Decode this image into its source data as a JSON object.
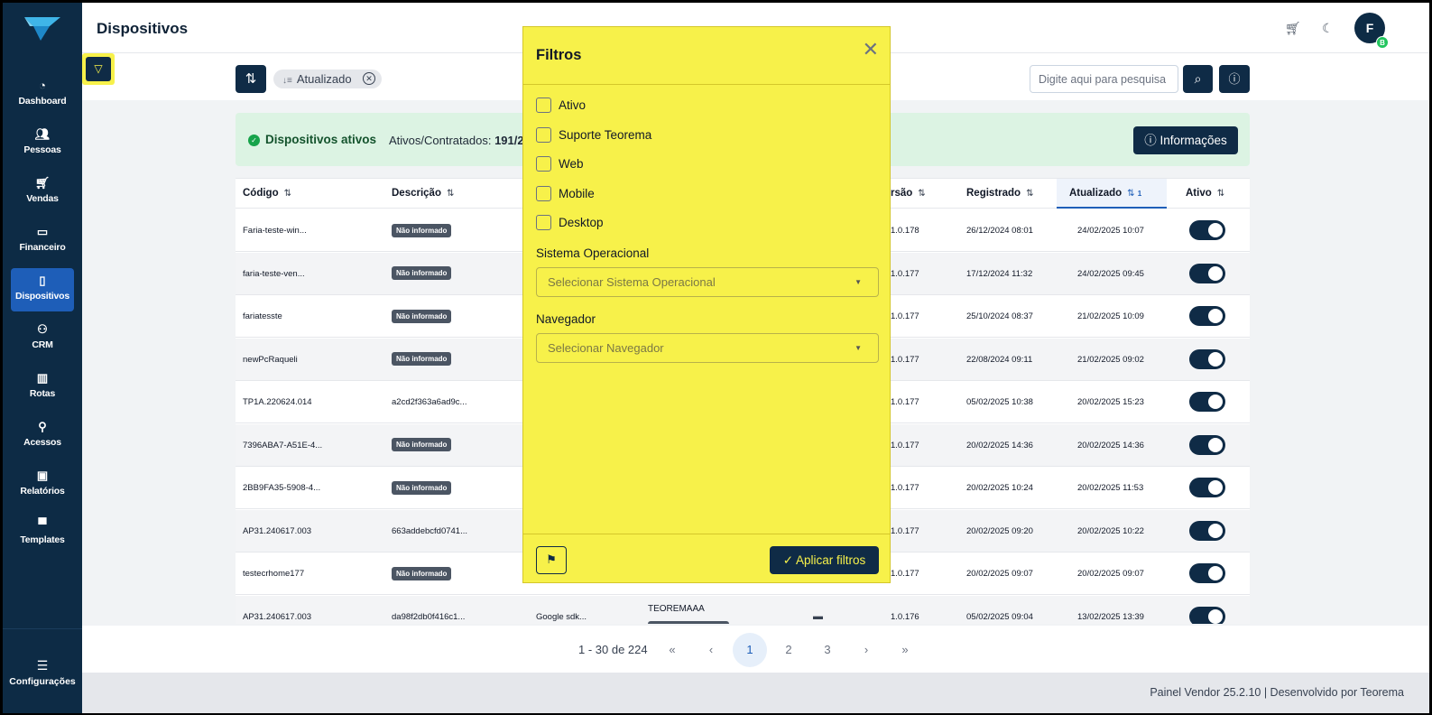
{
  "app": {
    "title": "Dispositivos",
    "brand_color": "#0d2b45",
    "accent_color": "#1e5eb8",
    "highlight_color": "#f7f14a"
  },
  "sidebar": {
    "logo": "teorema-logo",
    "items": [
      {
        "label": "Dashboard",
        "icon": "dashboard-icon"
      },
      {
        "label": "Pessoas",
        "icon": "people-icon"
      },
      {
        "label": "Vendas",
        "icon": "cart-icon"
      },
      {
        "label": "Financeiro",
        "icon": "wallet-icon"
      },
      {
        "label": "Dispositivos",
        "icon": "device-icon",
        "active": true
      },
      {
        "label": "CRM",
        "icon": "crm-icon"
      },
      {
        "label": "Rotas",
        "icon": "map-icon"
      },
      {
        "label": "Acessos",
        "icon": "access-icon"
      },
      {
        "label": "Relatórios",
        "icon": "report-icon"
      },
      {
        "label": "Templates",
        "icon": "template-icon"
      }
    ],
    "config_label": "Configurações"
  },
  "header": {
    "avatar_letter": "F",
    "avatar_badge": "B"
  },
  "toolbar": {
    "chip_label": "Atualizado",
    "search_placeholder": "Digite aqui para pesquisa"
  },
  "status": {
    "title": "Dispositivos ativos",
    "ratio_label": "Ativos/Contratados:",
    "ratio_value": "191/2",
    "info_label": "Informações"
  },
  "table": {
    "headers": {
      "codigo": "Código",
      "descricao": "Descrição",
      "versao": "rsão",
      "registrado": "Registrado",
      "atualizado": "Atualizado",
      "atualizado_order": "1",
      "ativo": "Ativo"
    },
    "rows": [
      {
        "codigo": "Faria-teste-win...",
        "descricao": "Não informado",
        "desc_badge": true,
        "versao": "1.0.178",
        "registrado": "26/12/2024 08:01",
        "atualizado": "24/02/2025 10:07"
      },
      {
        "codigo": "faria-teste-ven...",
        "descricao": "Não informado",
        "desc_badge": true,
        "versao": "1.0.177",
        "registrado": "17/12/2024 11:32",
        "atualizado": "24/02/2025 09:45"
      },
      {
        "codigo": "fariatesste",
        "descricao": "Não informado",
        "desc_badge": true,
        "versao": "1.0.177",
        "registrado": "25/10/2024 08:37",
        "atualizado": "21/02/2025 10:09"
      },
      {
        "codigo": "newPcRaqueli",
        "descricao": "Não informado",
        "desc_badge": true,
        "versao": "1.0.177",
        "registrado": "22/08/2024 09:11",
        "atualizado": "21/02/2025 09:02"
      },
      {
        "codigo": "TP1A.220624.014",
        "descricao": "a2cd2f363a6ad9c...",
        "desc_badge": false,
        "versao": "1.0.177",
        "registrado": "05/02/2025 10:38",
        "atualizado": "20/02/2025 15:23"
      },
      {
        "codigo": "7396ABA7-A51E-4...",
        "descricao": "Não informado",
        "desc_badge": true,
        "versao": "1.0.177",
        "registrado": "20/02/2025 14:36",
        "atualizado": "20/02/2025 14:36"
      },
      {
        "codigo": "2BB9FA35-5908-4...",
        "descricao": "Não informado",
        "desc_badge": true,
        "versao": "1.0.177",
        "registrado": "20/02/2025 10:24",
        "atualizado": "20/02/2025 11:53"
      },
      {
        "codigo": "AP31.240617.003",
        "descricao": "663addebcfd0741...",
        "desc_badge": false,
        "versao": "1.0.177",
        "registrado": "20/02/2025 09:20",
        "atualizado": "20/02/2025 10:22"
      },
      {
        "codigo": "testecrhome177",
        "descricao": "Não informado",
        "desc_badge": true,
        "versao": "1.0.177",
        "registrado": "20/02/2025 09:07",
        "atualizado": "20/02/2025 09:07"
      },
      {
        "codigo": "AP31.240617.003",
        "descricao": "da98f2db0f416c1...",
        "desc_badge": false,
        "navegador": "Google sdk...",
        "usuario": "TEOREMAAA",
        "versao": "1.0.176",
        "registrado": "05/02/2025 09:04",
        "atualizado": "13/02/2025 13:39"
      }
    ]
  },
  "pagination": {
    "info": "1 - 30 de 224",
    "first": "«",
    "prev": "‹",
    "pages": [
      "1",
      "2",
      "3"
    ],
    "next": "›",
    "last": "»"
  },
  "footer": {
    "text": "Painel Vendor  25.2.10  |  Desenvolvido por Teorema"
  },
  "modal": {
    "title": "Filtros",
    "checkboxes": [
      "Ativo",
      "Suporte Teorema",
      "Web",
      "Mobile",
      "Desktop"
    ],
    "so_label": "Sistema Operacional",
    "so_placeholder": "Selecionar Sistema Operacional",
    "nav_label": "Navegador",
    "nav_placeholder": "Selecionar Navegador",
    "apply_label": "Aplicar filtros"
  }
}
